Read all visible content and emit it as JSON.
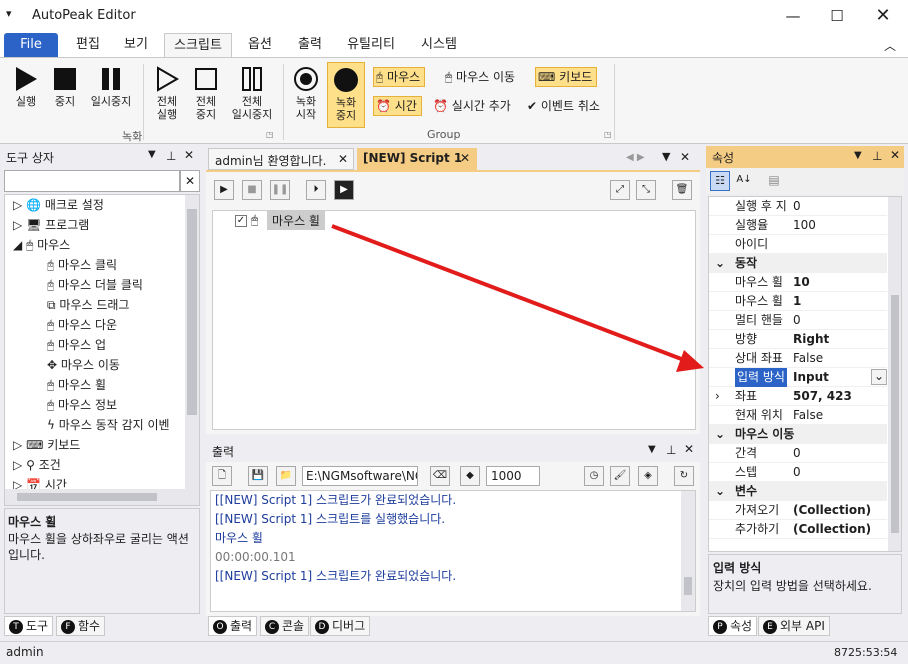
{
  "app": {
    "title": "AutoPeak Editor"
  },
  "menu": {
    "file": "File",
    "tabs": [
      "편집",
      "보기",
      "스크립트",
      "옵션",
      "출력",
      "유틸리티",
      "시스템"
    ]
  },
  "ribbon": {
    "record_group_label": "녹화",
    "group_label": "Group",
    "buttons": {
      "run": "실행",
      "stop": "중지",
      "pause": "일시중지",
      "run_all_1": "전체",
      "run_all_2": "실행",
      "stop_all_1": "전체",
      "stop_all_2": "중지",
      "pause_all_1": "전체",
      "pause_all_2": "일시중지",
      "rec_start_1": "녹화",
      "rec_start_2": "시작",
      "rec_stop_1": "녹화",
      "rec_stop_2": "중지"
    },
    "chips": {
      "mouse": "마우스",
      "mouse_move": "마우스 이동",
      "keyboard": "키보드",
      "time": "시간",
      "realtime_add": "실시간 추가",
      "event_cancel": "이벤트 취소"
    }
  },
  "toolbox": {
    "title": "도구 상자",
    "items": [
      "매크로 설정",
      "프로그램",
      "마우스",
      "마우스 클릭",
      "마우스 더블 클릭",
      "마우스 드래그",
      "마우스 다운",
      "마우스 업",
      "마우스 이동",
      "마우스 휠",
      "마우스 정보",
      "마우스 동작 감지 이벤",
      "키보드",
      "조건",
      "시간"
    ],
    "desc_title": "마우스 휠",
    "desc_text": "마우스 휠을 상하좌우로 굴리는 액션입니다.",
    "tabs": [
      "도구",
      "함수"
    ]
  },
  "editor": {
    "tabs": [
      "admin님 환영합니다.",
      "[NEW] Script 1"
    ],
    "node_label": "마우스 휠"
  },
  "output": {
    "title": "출력",
    "path": "E:\\NGMsoftware\\NG",
    "count": "1000",
    "lines": [
      {
        "text": "[[NEW] Script 1] 스크립트가 완료되었습니다.",
        "cls": "blue"
      },
      {
        "text": "[[NEW] Script 1] 스크립트를 실행했습니다.",
        "cls": "blue"
      },
      {
        "text": "마우스 휠",
        "cls": "blue"
      },
      {
        "text": "00:00:00.101",
        "cls": "gray"
      },
      {
        "text": "[[NEW] Script 1] 스크립트가 완료되었습니다.",
        "cls": "blue"
      }
    ],
    "tabs": [
      "출력",
      "콘솔",
      "디버그"
    ]
  },
  "properties": {
    "title": "속성",
    "rows": [
      {
        "k": "실행 후 지",
        "v": "0"
      },
      {
        "k": "실행율",
        "v": "100"
      },
      {
        "k": "아이디",
        "v": ""
      },
      {
        "cat": "동작"
      },
      {
        "k": "마우스 휠",
        "v": "10",
        "b": true
      },
      {
        "k": "마우스 휠",
        "v": "1",
        "b": true
      },
      {
        "k": "멀티 핸들",
        "v": "0"
      },
      {
        "k": "방향",
        "v": "Right",
        "b": true
      },
      {
        "k": "상대 좌표",
        "v": "False"
      },
      {
        "k": "입력 방식",
        "v": "Input",
        "b": true,
        "sel": true
      },
      {
        "k": "좌표",
        "v": "507, 423",
        "b": true,
        "exp": true
      },
      {
        "k": "현재 위치",
        "v": "False"
      },
      {
        "cat": "마우스 이동"
      },
      {
        "k": "간격",
        "v": "0"
      },
      {
        "k": "스텝",
        "v": "0"
      },
      {
        "cat": "변수"
      },
      {
        "k": "가져오기",
        "v": "(Collection)",
        "b": true
      },
      {
        "k": "추가하기",
        "v": "(Collection)",
        "b": true
      }
    ],
    "desc_title": "입력 방식",
    "desc_text": "장치의 입력 방법을 선택하세요.",
    "tabs": [
      "속성",
      "외부 API"
    ]
  },
  "status": {
    "user": "admin",
    "clock": "8725:53:54"
  },
  "colors": {
    "accent": "#2b63c7",
    "highlight": "#f5cc84",
    "arrow": "#e21b1b"
  }
}
